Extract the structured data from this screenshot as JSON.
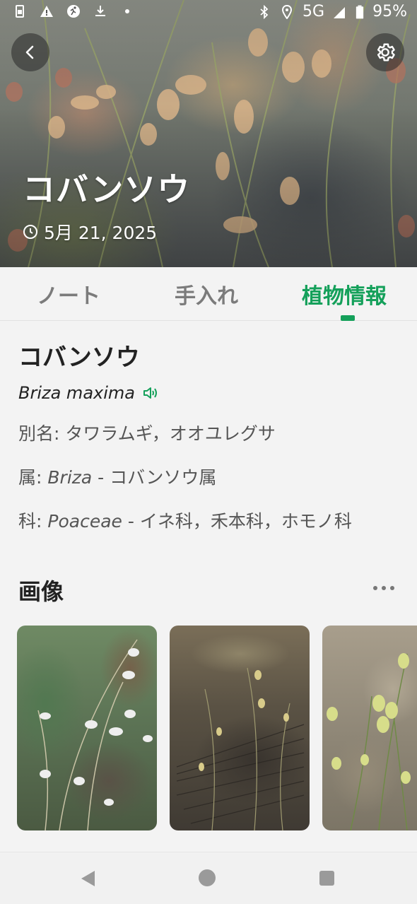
{
  "status_bar": {
    "network": "5G",
    "battery_percent": "95%",
    "icons_left": [
      "sim-icon",
      "warning-icon",
      "runner-icon",
      "download-icon",
      "dot-icon"
    ],
    "icons_right": [
      "bluetooth-icon",
      "location-icon",
      "signal-icon",
      "battery-icon"
    ]
  },
  "header": {
    "title": "コバンソウ",
    "date": "5月 21, 2025",
    "back_icon": "chevron-left-icon",
    "settings_icon": "gear-icon",
    "date_icon": "clock-icon"
  },
  "tabs": [
    {
      "label": "ノート",
      "active": false
    },
    {
      "label": "手入れ",
      "active": false
    },
    {
      "label": "植物情報",
      "active": true
    }
  ],
  "plant_info": {
    "common_name": "コバンソウ",
    "scientific_name": "Briza maxima",
    "alias_label": "別名:",
    "alias_value": "タワラムギ，オオユレグサ",
    "genus_label": "属:",
    "genus_latin": "Briza",
    "genus_value": " - コバンソウ属",
    "family_label": "科:",
    "family_latin": "Poaceae",
    "family_value": " - イネ科，禾本科，ホモノ科"
  },
  "images_section": {
    "title": "画像",
    "images": [
      {
        "description_icon": "plant-photo"
      },
      {
        "description_icon": "plant-photo"
      },
      {
        "description_icon": "plant-photo"
      }
    ]
  },
  "colors": {
    "accent": "#14a05a",
    "tab_inactive": "#7b7b7b",
    "background": "#f3f3f3"
  }
}
